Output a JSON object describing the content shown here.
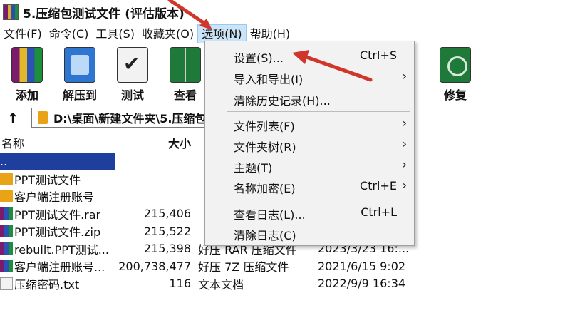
{
  "window": {
    "title": "5.压缩包测试文件 (评估版本)"
  },
  "menubar": [
    "文件(F)",
    "命令(C)",
    "工具(S)",
    "收藏夹(O)",
    "选项(N)",
    "帮助(H)"
  ],
  "toolbar": {
    "add": "添加",
    "extract": "解压到",
    "test": "测试",
    "view": "查看",
    "repair": "修复"
  },
  "address": {
    "path": "D:\\桌面\\新建文件夹\\5.压缩包"
  },
  "columns": {
    "name": "名称",
    "size": "大小"
  },
  "files": [
    {
      "name": "..",
      "size": "",
      "type": "",
      "date": "",
      "icon": "folder-up"
    },
    {
      "name": "PPT测试文件",
      "size": "",
      "type": "",
      "date": "",
      "icon": "folder"
    },
    {
      "name": "客户端注册账号",
      "size": "",
      "type": "",
      "date": "",
      "icon": "folder"
    },
    {
      "name": "PPT测试文件.rar",
      "size": "215,406",
      "type": "",
      "date": "",
      "icon": "archive"
    },
    {
      "name": "PPT测试文件.zip",
      "size": "215,522",
      "type": "",
      "date": "",
      "icon": "archive"
    },
    {
      "name": "rebuilt.PPT测试...",
      "size": "215,398",
      "type": "好压 RAR 压缩文件",
      "date": "2023/3/23 16:...",
      "icon": "archive"
    },
    {
      "name": "客户端注册账号...",
      "size": "200,738,477",
      "type": "好压 7Z 压缩文件",
      "date": "2021/6/15 9:02",
      "icon": "archive"
    },
    {
      "name": "压缩密码.txt",
      "size": "116",
      "type": "文本文档",
      "date": "2022/9/9 16:34",
      "icon": "text"
    }
  ],
  "options_menu": {
    "settings": {
      "label": "设置(S)...",
      "shortcut": "Ctrl+S"
    },
    "import_export": {
      "label": "导入和导出(I)",
      "arrow": "›"
    },
    "clear_history": {
      "label": "清除历史记录(H)..."
    },
    "file_list": {
      "label": "文件列表(F)",
      "arrow": "›"
    },
    "folder_tree": {
      "label": "文件夹树(R)",
      "arrow": "›"
    },
    "theme": {
      "label": "主题(T)",
      "arrow": "›"
    },
    "name_encrypt": {
      "label": "名称加密(E)",
      "shortcut": "Ctrl+E",
      "arrow": "›"
    },
    "view_log": {
      "label": "查看日志(L)...",
      "shortcut": "Ctrl+L"
    },
    "clear_log": {
      "label": "清除日志(C)"
    }
  },
  "colors": {
    "accent_arrow": "#d0362a",
    "selection": "#1e3f9e",
    "menu_highlight": "#cce4f7"
  }
}
